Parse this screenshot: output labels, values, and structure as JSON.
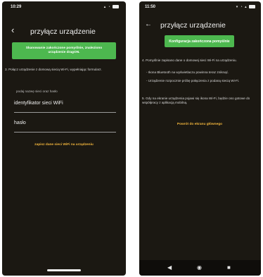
{
  "left": {
    "status": {
      "time": "10:29",
      "icons": "▴ ◔"
    },
    "title": "przyłącz urządzenie",
    "back_icon": "‹",
    "success_banner": "Skanowanie zakończone pomyślnie, znaleziono urządzenie dragON.",
    "instruction": "3. Połącz urządzenie z domową siecią Wi-Fi, wypełniając formularz.",
    "field_hint": "podaj nazwę sieci oraz hasło",
    "wifi_field": "identyfikator sieci WiFi",
    "password_field": "hasło",
    "action_button": "zapisz dane sieci WiFi na urządzeniu"
  },
  "right": {
    "status": {
      "time": "11:50",
      "icons": "▾ ◔ ▴"
    },
    "title": "przyłącz urządzenie",
    "back_icon": "←",
    "success_banner": "Konfiguracja zakończona pomyślnie",
    "step4": "4. Pomyślnie zapisano dane o domowej sieci Wi-Fi na urządzeniu.",
    "bullet1": "- Ikona Bluetooth na wyświetlaczu powinna teraz zniknąć.",
    "bullet2": "- Urządzenie rozpocznie próbę połączenia z podaną siecią Wi-Fi.",
    "step5": "5. Gdy na ekranie urządzenia pojawi się ikona Wi-Fi, będzie ono gotowe do współpracy z aplikacją mobilną.",
    "action_button": "Powrót do ekranu głównego",
    "nav": {
      "back": "◀",
      "home": "◉",
      "recents": "■"
    }
  },
  "colors": {
    "success": "#4db84f",
    "accent": "#f3b63c",
    "background": "#1b1812"
  }
}
